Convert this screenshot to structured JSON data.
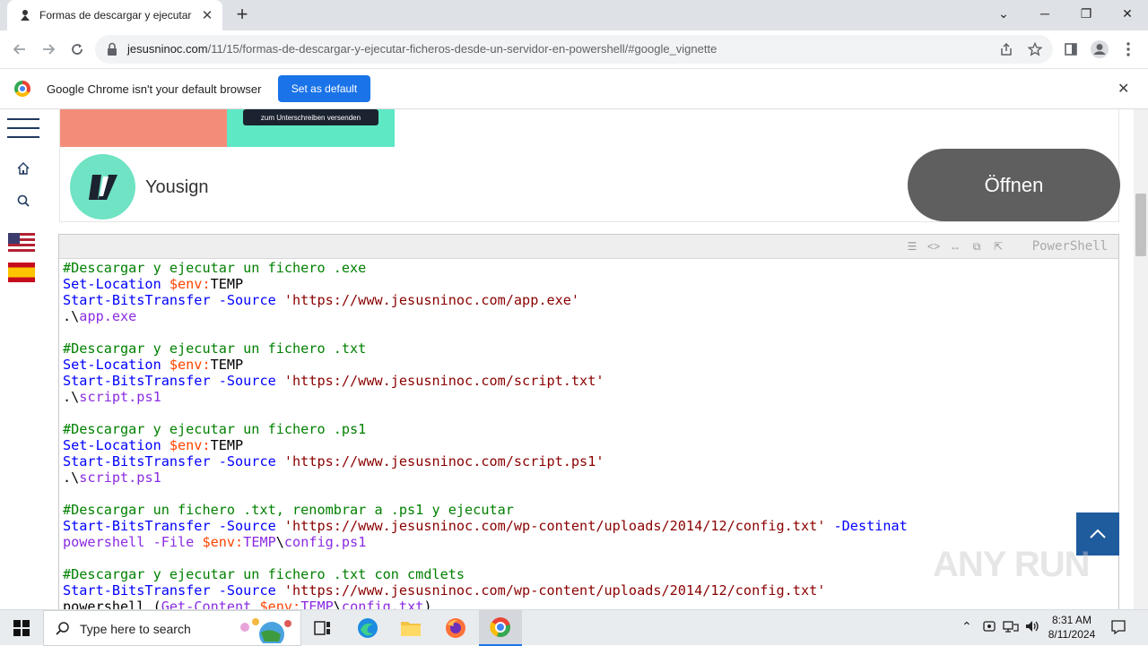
{
  "browser": {
    "tab": {
      "title": "Formas de descargar y ejecutar fi",
      "close": "✕"
    },
    "new_tab": "+",
    "window": {
      "minimize": "─",
      "restore": "❐",
      "close": "✕",
      "dropdown": "⌄"
    },
    "address": {
      "domain": "jesusninoc.com",
      "path": "/11/15/formas-de-descargar-y-ejecutar-ficheros-desde-un-servidor-en-powershell/#google_vignette"
    },
    "infobar": {
      "message": "Google Chrome isn't your default browser",
      "button": "Set as default"
    }
  },
  "ad": {
    "badge": "zum Unterschreiben versenden",
    "brand": "Yousign",
    "cta": "Öffnen"
  },
  "codebox": {
    "language": "PowerShell",
    "lines": [
      [
        {
          "t": "#Descargar y ejecutar un fichero .exe",
          "c": "c-com"
        }
      ],
      [
        {
          "t": "Set-Location ",
          "c": "c-cmd"
        },
        {
          "t": "$env:",
          "c": "c-var"
        },
        {
          "t": "TEMP",
          "c": "c-plain"
        }
      ],
      [
        {
          "t": "Start-BitsTransfer -Source ",
          "c": "c-cmd"
        },
        {
          "t": "'https://www.jesusninoc.com/app.exe'",
          "c": "c-str"
        }
      ],
      [
        {
          "t": ".\\",
          "c": "c-plain"
        },
        {
          "t": "app.exe",
          "c": "c-path"
        }
      ],
      [],
      [
        {
          "t": "#Descargar y ejecutar un fichero .txt",
          "c": "c-com"
        }
      ],
      [
        {
          "t": "Set-Location ",
          "c": "c-cmd"
        },
        {
          "t": "$env:",
          "c": "c-var"
        },
        {
          "t": "TEMP",
          "c": "c-plain"
        }
      ],
      [
        {
          "t": "Start-BitsTransfer -Source ",
          "c": "c-cmd"
        },
        {
          "t": "'https://www.jesusninoc.com/script.txt'",
          "c": "c-str"
        }
      ],
      [
        {
          "t": ".\\",
          "c": "c-plain"
        },
        {
          "t": "script.ps1",
          "c": "c-path"
        }
      ],
      [],
      [
        {
          "t": "#Descargar y ejecutar un fichero .ps1",
          "c": "c-com"
        }
      ],
      [
        {
          "t": "Set-Location ",
          "c": "c-cmd"
        },
        {
          "t": "$env:",
          "c": "c-var"
        },
        {
          "t": "TEMP",
          "c": "c-plain"
        }
      ],
      [
        {
          "t": "Start-BitsTransfer -Source ",
          "c": "c-cmd"
        },
        {
          "t": "'https://www.jesusninoc.com/script.ps1'",
          "c": "c-str"
        }
      ],
      [
        {
          "t": ".\\",
          "c": "c-plain"
        },
        {
          "t": "script.ps1",
          "c": "c-path"
        }
      ],
      [],
      [
        {
          "t": "#Descargar un fichero .txt, renombrar a .ps1 y ejecutar",
          "c": "c-com"
        }
      ],
      [
        {
          "t": "Start-BitsTransfer -Source ",
          "c": "c-cmd"
        },
        {
          "t": "'https://www.jesusninoc.com/wp-content/uploads/2014/12/config.txt'",
          "c": "c-str"
        },
        {
          "t": " -Destinat",
          "c": "c-cmd"
        }
      ],
      [
        {
          "t": "powershell -File ",
          "c": "c-path"
        },
        {
          "t": "$env:",
          "c": "c-var"
        },
        {
          "t": "TEMP",
          "c": "c-path"
        },
        {
          "t": "\\",
          "c": "c-plain"
        },
        {
          "t": "config.ps1",
          "c": "c-path"
        }
      ],
      [],
      [
        {
          "t": "#Descargar y ejecutar un fichero .txt con cmdlets",
          "c": "c-com"
        }
      ],
      [
        {
          "t": "Start-BitsTransfer -Source ",
          "c": "c-cmd"
        },
        {
          "t": "'https://www.jesusninoc.com/wp-content/uploads/2014/12/config.txt'",
          "c": "c-str"
        }
      ],
      [
        {
          "t": "powershell (",
          "c": "c-plain"
        },
        {
          "t": "Get-Content ",
          "c": "c-path"
        },
        {
          "t": "$env:",
          "c": "c-var"
        },
        {
          "t": "TEMP",
          "c": "c-path"
        },
        {
          "t": "\\",
          "c": "c-plain"
        },
        {
          "t": "config.txt",
          "c": "c-path"
        },
        {
          "t": ")",
          "c": "c-plain"
        }
      ]
    ]
  },
  "taskbar": {
    "search_placeholder": "Type here to search",
    "time": "8:31 AM",
    "date": "8/11/2024"
  },
  "watermark": "ANY RUN",
  "colors": {
    "accent": "#1a73e8",
    "scroll_top": "#1f5c9e"
  }
}
